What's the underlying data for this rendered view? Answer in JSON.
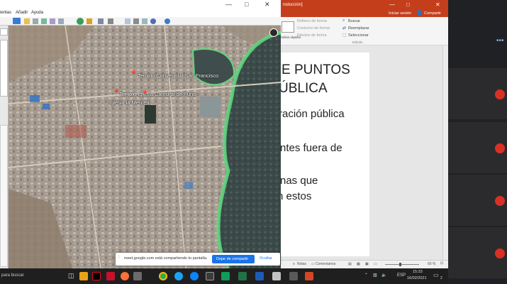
{
  "earth": {
    "menu": [
      "ientas",
      "Añadir",
      "Ayuda"
    ],
    "pins": [
      "Templo Conventual San Francisco",
      "Templo Iglesia Catedral de Puno",
      "Iglesia la Merced"
    ],
    "window_controls": [
      "—",
      "□",
      "✕"
    ]
  },
  "ppt": {
    "title_suffix": "roducción]",
    "signin": "Iniciar sesión",
    "share": "Compartir",
    "ribbon": {
      "fill": "Relleno de forma",
      "outline": "Contorno de forma",
      "effects": "Efectos de forma",
      "find": "Buscar",
      "replace": "Reemplazar",
      "select": "Seleccionar",
      "group": "Edición",
      "quick_styles": "Estilos rápidos"
    },
    "slide": {
      "line1": "E PUNTOS",
      "line2": "ÚBLICA",
      "line3": "ración pública",
      "line4": "ntes fuera de",
      "line5": "nas que",
      "line6": "n estos"
    },
    "status": {
      "notes": "Notas",
      "comments": "Comentarios",
      "zoom": "60 %"
    }
  },
  "sharebar": {
    "message": "meet.google.com está compartiendo tu pantalla.",
    "stop": "Dejar de compartir",
    "hide": "Ocultar"
  },
  "taskbar": {
    "search": "para buscar",
    "lang": "ESP",
    "time": "15:33",
    "date": "16/02/2021",
    "notif": "2"
  },
  "colors": {
    "ppt_red": "#c43e1c",
    "meet_bg": "#202124",
    "mute_red": "#d93025",
    "share_blue": "#1a73e8",
    "lake_green": "#5fd67e"
  }
}
